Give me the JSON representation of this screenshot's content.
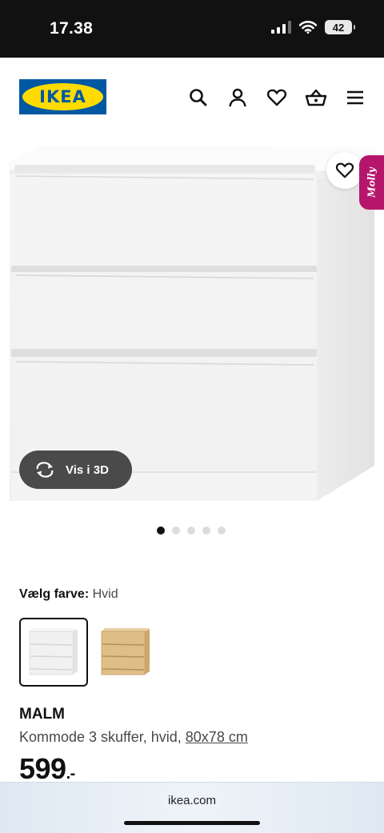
{
  "status_bar": {
    "time": "17.38",
    "battery": "42",
    "icons": [
      "signal-icon",
      "wifi-icon",
      "battery-icon"
    ]
  },
  "header": {
    "logo_text": "IKEA",
    "icons": [
      "search-icon",
      "account-icon",
      "wishlist-heart-icon",
      "shopping-basket-icon",
      "menu-icon"
    ]
  },
  "hero": {
    "favorite_icon": "heart-outline-icon",
    "chat_tab_label": "Molly",
    "view_3d_label": "Vis i 3D",
    "view_3d_icon": "rotate-arrows-icon",
    "carousel": {
      "total": 5,
      "active_index": 0
    }
  },
  "color_selection": {
    "heading": "Vælg farve:",
    "selected_value": "Hvid",
    "swatches": [
      "white-dresser-swatch",
      "oak-dresser-swatch"
    ]
  },
  "product": {
    "name": "MALM",
    "description": "Kommode 3 skuffer, hvid, ",
    "dimensions": "80x78 cm",
    "price": "599",
    "price_suffix": ".-"
  },
  "browser": {
    "url": "ikea.com"
  },
  "colors": {
    "brand_blue": "#0058a3",
    "brand_yellow": "#ffdb00",
    "chat_tab": "#b5166b",
    "view_3d_button": "#4a4a4a"
  }
}
